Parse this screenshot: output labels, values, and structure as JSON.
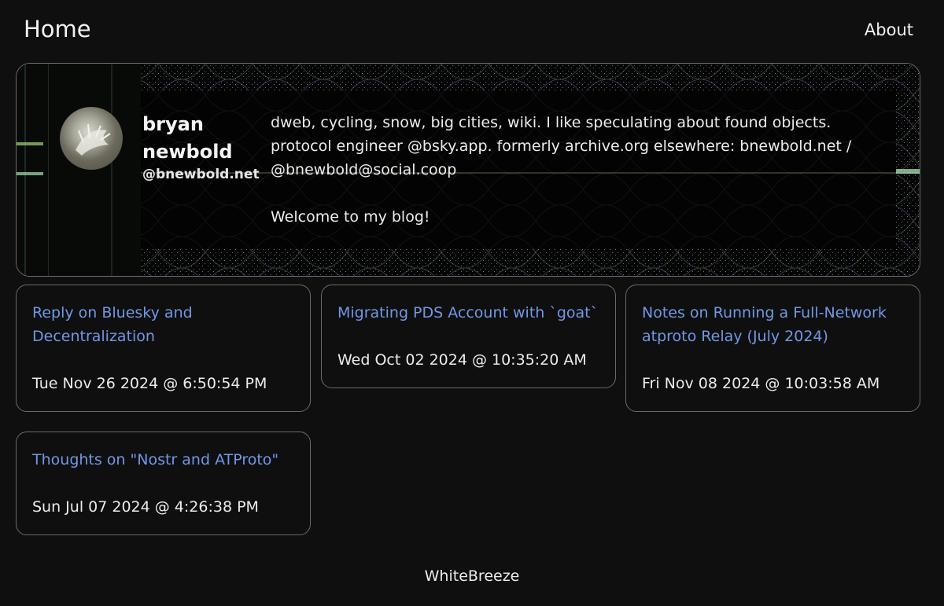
{
  "nav": {
    "home_label": "Home",
    "about_label": "About"
  },
  "profile": {
    "display_name": "bryan newbold",
    "handle": "@bnewbold.net",
    "bio": "dweb, cycling, snow, big cities, wiki. I like speculating about found objects. protocol engineer @bsky.app. formerly archive.org elsewhere: bnewbold.net / @bnewbold@social.coop",
    "welcome": "Welcome to my blog!"
  },
  "posts": [
    {
      "title": "Reply on Bluesky and Decentralization",
      "date": "Tue Nov 26 2024 @ 6:50:54 PM"
    },
    {
      "title": "Migrating PDS Account with `goat`",
      "date": "Wed Oct 02 2024 @ 10:35:20 AM"
    },
    {
      "title": "Notes on Running a Full-Network atproto Relay (July 2024)",
      "date": "Fri Nov 08 2024 @ 10:03:58 AM"
    },
    {
      "title": "Thoughts on \"Nostr and ATProto\"",
      "date": "Sun Jul 07 2024 @ 4:26:38 PM"
    }
  ],
  "footer": {
    "text": "WhiteBreeze"
  },
  "colors": {
    "background": "#0f0f0f",
    "link": "#6f98e6",
    "border": "#6a6a6a"
  }
}
